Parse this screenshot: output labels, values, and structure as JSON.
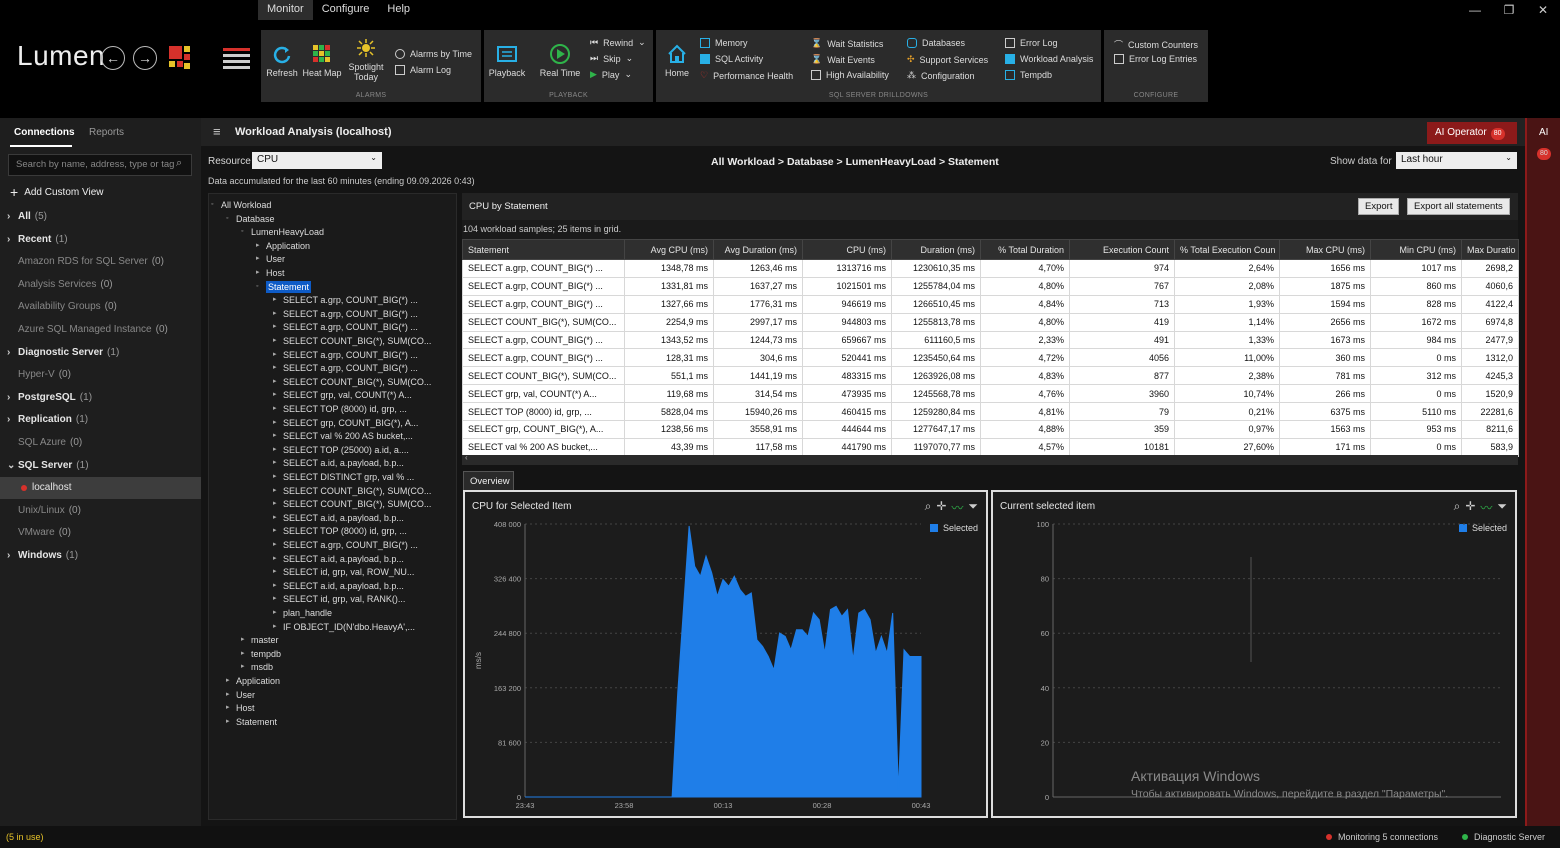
{
  "menu": [
    "Monitor",
    "Configure",
    "Help"
  ],
  "app": {
    "logo": "Lumen"
  },
  "ribbon": {
    "alarms": {
      "label": "ALARMS",
      "refresh": "Refresh",
      "heatmap": "Heat Map",
      "spotlight": "Spotlight Today",
      "alarms_by_time": "Alarms by Time",
      "alarm_log": "Alarm Log"
    },
    "playback": {
      "label": "PLAYBACK",
      "playback": "Playback",
      "realtime": "Real Time",
      "rewind": "Rewind",
      "skip": "Skip",
      "play": "Play"
    },
    "drilldowns": {
      "label": "SQL SERVER DRILLDOWNS",
      "home": "Home",
      "memory": "Memory",
      "sql_activity": "SQL Activity",
      "performance_health": "Performance Health",
      "wait_statistics": "Wait Statistics",
      "wait_events": "Wait Events",
      "high_availability": "High Availability",
      "databases": "Databases",
      "support_services": "Support Services",
      "configuration": "Configuration",
      "error_log": "Error Log",
      "workload_analysis": "Workload Analysis",
      "tempdb": "Tempdb"
    },
    "configure": {
      "label": "CONFIGURE",
      "custom_counters": "Custom Counters",
      "error_log_entries": "Error Log Entries"
    }
  },
  "left": {
    "tabs": [
      "Connections",
      "Reports"
    ],
    "search_placeholder": "Search by name, address, type or tag",
    "add_custom_view": "Add Custom View",
    "items": [
      {
        "label": "All",
        "count": "(5)",
        "bold": true,
        "caret": true
      },
      {
        "label": "Recent",
        "count": "(1)",
        "bold": true,
        "caret": true
      },
      {
        "label": "Amazon RDS for SQL Server",
        "count": "(0)",
        "bold": false
      },
      {
        "label": "Analysis Services",
        "count": "(0)",
        "bold": false
      },
      {
        "label": "Availability Groups",
        "count": "(0)",
        "bold": false
      },
      {
        "label": "Azure SQL Managed Instance",
        "count": "(0)",
        "bold": false
      },
      {
        "label": "Diagnostic Server",
        "count": "(1)",
        "bold": true,
        "caret": true
      },
      {
        "label": "Hyper-V",
        "count": "(0)",
        "bold": false
      },
      {
        "label": "PostgreSQL",
        "count": "(1)",
        "bold": true,
        "caret": true
      },
      {
        "label": "Replication",
        "count": "(1)",
        "bold": true,
        "caret": true
      },
      {
        "label": "SQL Azure",
        "count": "(0)",
        "bold": false
      },
      {
        "label": "SQL Server",
        "count": "(1)",
        "bold": true,
        "caret": true,
        "open": true
      },
      {
        "label": "localhost",
        "count": "",
        "bold": false,
        "child": true,
        "selected": true
      },
      {
        "label": "Unix/Linux",
        "count": "(0)",
        "bold": false
      },
      {
        "label": "VMware",
        "count": "(0)",
        "bold": false
      },
      {
        "label": "Windows",
        "count": "(1)",
        "bold": true,
        "caret": true
      }
    ]
  },
  "main": {
    "title": "Workload Analysis (localhost)",
    "ai_operator": "AI Operator",
    "ai_badge": "80",
    "ai_strip": "AI",
    "resource_label": "Resource",
    "resource_value": "CPU",
    "accumulated": "Data accumulated for the last 60 minutes (ending 09.09.2026 0:43)",
    "breadcrumb": "All Workload > Database > LumenHeavyLoad > Statement",
    "show_data_for": "Show data for",
    "period": "Last hour"
  },
  "tree": [
    {
      "t": "All Workload",
      "l": 0,
      "c": "◦"
    },
    {
      "t": "Database",
      "l": 1,
      "c": "◦"
    },
    {
      "t": "LumenHeavyLoad",
      "l": 2,
      "c": "◦"
    },
    {
      "t": "Application",
      "l": 3,
      "c": "▸"
    },
    {
      "t": "User",
      "l": 3,
      "c": "▸"
    },
    {
      "t": "Host",
      "l": 3,
      "c": "▸"
    },
    {
      "t": "Statement",
      "l": 3,
      "c": "◦",
      "sel": true
    },
    {
      "t": "SELECT a.grp, COUNT_BIG(*) ...",
      "l": 4,
      "c": "▸"
    },
    {
      "t": "SELECT a.grp, COUNT_BIG(*) ...",
      "l": 4,
      "c": "▸"
    },
    {
      "t": "SELECT a.grp, COUNT_BIG(*) ...",
      "l": 4,
      "c": "▸"
    },
    {
      "t": "SELECT COUNT_BIG(*), SUM(CO...",
      "l": 4,
      "c": "▸"
    },
    {
      "t": "SELECT a.grp, COUNT_BIG(*) ...",
      "l": 4,
      "c": "▸"
    },
    {
      "t": "SELECT a.grp, COUNT_BIG(*) ...",
      "l": 4,
      "c": "▸"
    },
    {
      "t": "SELECT COUNT_BIG(*), SUM(CO...",
      "l": 4,
      "c": "▸"
    },
    {
      "t": "SELECT grp, val, COUNT(*) A...",
      "l": 4,
      "c": "▸"
    },
    {
      "t": "SELECT TOP (8000) id, grp, ...",
      "l": 4,
      "c": "▸"
    },
    {
      "t": "SELECT grp, COUNT_BIG(*), A...",
      "l": 4,
      "c": "▸"
    },
    {
      "t": "SELECT val % 200 AS bucket,...",
      "l": 4,
      "c": "▸"
    },
    {
      "t": "SELECT TOP (25000) a.id, a....",
      "l": 4,
      "c": "▸"
    },
    {
      "t": "SELECT a.id, a.payload, b.p...",
      "l": 4,
      "c": "▸"
    },
    {
      "t": "SELECT DISTINCT grp, val % ...",
      "l": 4,
      "c": "▸"
    },
    {
      "t": "SELECT COUNT_BIG(*), SUM(CO...",
      "l": 4,
      "c": "▸"
    },
    {
      "t": "SELECT COUNT_BIG(*), SUM(CO...",
      "l": 4,
      "c": "▸"
    },
    {
      "t": "SELECT a.id, a.payload, b.p...",
      "l": 4,
      "c": "▸"
    },
    {
      "t": "SELECT TOP (8000) id, grp, ...",
      "l": 4,
      "c": "▸"
    },
    {
      "t": "SELECT a.grp, COUNT_BIG(*) ...",
      "l": 4,
      "c": "▸"
    },
    {
      "t": "SELECT a.id, a.payload, b.p...",
      "l": 4,
      "c": "▸"
    },
    {
      "t": "SELECT id, grp, val, ROW_NU...",
      "l": 4,
      "c": "▸"
    },
    {
      "t": "SELECT a.id, a.payload, b.p...",
      "l": 4,
      "c": "▸"
    },
    {
      "t": "SELECT id, grp, val, RANK()...",
      "l": 4,
      "c": "▸"
    },
    {
      "t": "plan_handle",
      "l": 4,
      "c": "▸"
    },
    {
      "t": "IF OBJECT_ID(N'dbo.HeavyA',...",
      "l": 4,
      "c": "▸"
    },
    {
      "t": "master",
      "l": 2,
      "c": "▸"
    },
    {
      "t": "tempdb",
      "l": 2,
      "c": "▸"
    },
    {
      "t": "msdb",
      "l": 2,
      "c": "▸"
    },
    {
      "t": "Application",
      "l": 1,
      "c": "▸"
    },
    {
      "t": "User",
      "l": 1,
      "c": "▸"
    },
    {
      "t": "Host",
      "l": 1,
      "c": "▸"
    },
    {
      "t": "Statement",
      "l": 1,
      "c": "▸"
    }
  ],
  "grid": {
    "title": "CPU by Statement",
    "export": "Export",
    "export_all": "Export all statements",
    "summary": "104 workload samples; 25 items in grid.",
    "columns": [
      "Statement",
      "Avg CPU (ms)",
      "Avg Duration (ms)",
      "CPU (ms)",
      "Duration (ms)",
      "% Total Duration",
      "Execution Count",
      "% Total Execution Coun",
      "Max CPU (ms)",
      "Min CPU (ms)",
      "Max Duratio"
    ],
    "rows": [
      [
        "SELECT a.grp, COUNT_BIG(*) ...",
        "1348,78 ms",
        "1263,46 ms",
        "1313716 ms",
        "1230610,35 ms",
        "4,70%",
        "974",
        "2,64%",
        "1656 ms",
        "1017 ms",
        "2698,2"
      ],
      [
        "SELECT a.grp, COUNT_BIG(*) ...",
        "1331,81 ms",
        "1637,27 ms",
        "1021501 ms",
        "1255784,04 ms",
        "4,80%",
        "767",
        "2,08%",
        "1875 ms",
        "860 ms",
        "4060,6"
      ],
      [
        "SELECT a.grp, COUNT_BIG(*) ...",
        "1327,66 ms",
        "1776,31 ms",
        "946619 ms",
        "1266510,45 ms",
        "4,84%",
        "713",
        "1,93%",
        "1594 ms",
        "828 ms",
        "4122,4"
      ],
      [
        "SELECT COUNT_BIG(*), SUM(CO...",
        "2254,9 ms",
        "2997,17 ms",
        "944803 ms",
        "1255813,78 ms",
        "4,80%",
        "419",
        "1,14%",
        "2656 ms",
        "1672 ms",
        "6974,8"
      ],
      [
        "SELECT a.grp, COUNT_BIG(*) ...",
        "1343,52 ms",
        "1244,73 ms",
        "659667 ms",
        "611160,5 ms",
        "2,33%",
        "491",
        "1,33%",
        "1673 ms",
        "984 ms",
        "2477,9"
      ],
      [
        "SELECT a.grp, COUNT_BIG(*) ...",
        "128,31 ms",
        "304,6 ms",
        "520441 ms",
        "1235450,64 ms",
        "4,72%",
        "4056",
        "11,00%",
        "360 ms",
        "0 ms",
        "1312,0"
      ],
      [
        "SELECT COUNT_BIG(*), SUM(CO...",
        "551,1 ms",
        "1441,19 ms",
        "483315 ms",
        "1263926,08 ms",
        "4,83%",
        "877",
        "2,38%",
        "781 ms",
        "312 ms",
        "4245,3"
      ],
      [
        "SELECT grp, val, COUNT(*) A...",
        "119,68 ms",
        "314,54 ms",
        "473935 ms",
        "1245568,78 ms",
        "4,76%",
        "3960",
        "10,74%",
        "266 ms",
        "0 ms",
        "1520,9"
      ],
      [
        "SELECT TOP (8000) id, grp, ...",
        "5828,04 ms",
        "15940,26 ms",
        "460415 ms",
        "1259280,84 ms",
        "4,81%",
        "79",
        "0,21%",
        "6375 ms",
        "5110 ms",
        "22281,6"
      ],
      [
        "SELECT grp, COUNT_BIG(*), A...",
        "1238,56 ms",
        "3558,91 ms",
        "444644 ms",
        "1277647,17 ms",
        "4,88%",
        "359",
        "0,97%",
        "1563 ms",
        "953 ms",
        "8211,6"
      ],
      [
        "SELECT val % 200 AS bucket,...",
        "43,39 ms",
        "117,58 ms",
        "441790 ms",
        "1197070,77 ms",
        "4,57%",
        "10181",
        "27,60%",
        "171 ms",
        "0 ms",
        "583,9"
      ]
    ]
  },
  "overview_tab": "Overview",
  "chart_data": [
    {
      "type": "area",
      "title": "CPU for Selected Item",
      "ylabel": "ms/s",
      "legend": "Selected",
      "legend_position": "top-right",
      "ylim": [
        0,
        408000
      ],
      "yticks": [
        "408 000",
        "326 400",
        "244 800",
        "163 200",
        "81 600",
        "0"
      ],
      "xticks": [
        "23:43",
        "23:58",
        "00:13",
        "00:28",
        "00:43"
      ],
      "x_minutes": [
        0,
        26,
        27,
        29,
        30,
        31,
        32,
        33,
        34,
        35,
        36,
        37,
        38,
        39,
        40,
        41,
        42,
        43,
        44,
        45,
        46,
        47,
        48,
        49,
        50,
        51,
        52,
        53,
        54,
        55,
        56,
        57,
        58,
        59,
        60,
        61,
        62,
        63,
        64,
        65,
        66,
        67,
        68,
        69,
        70
      ],
      "values": [
        0,
        0,
        155000,
        405000,
        345000,
        330000,
        360000,
        335000,
        300000,
        325000,
        315000,
        330000,
        310000,
        300000,
        305000,
        235000,
        225000,
        210000,
        190000,
        245000,
        240000,
        220000,
        250000,
        250000,
        240000,
        275000,
        265000,
        215000,
        280000,
        285000,
        270000,
        280000,
        205000,
        275000,
        280000,
        265000,
        215000,
        240000,
        215000,
        275000,
        10000,
        220000,
        210000,
        210000,
        210000
      ]
    },
    {
      "type": "line",
      "title": "Current selected item",
      "legend": "Selected",
      "legend_position": "top-right",
      "ylim": [
        0,
        100
      ],
      "yticks": [
        "100",
        "80",
        "60",
        "40",
        "20",
        "0"
      ]
    }
  ],
  "watermark": {
    "line1": "Активация Windows",
    "line2": "Чтобы активировать Windows, перейдите в раздел \"Параметры\"."
  },
  "status": {
    "left": "(5 in use)",
    "monitoring": "Monitoring 5 connections",
    "diagnostic": "Diagnostic Server"
  },
  "colors": {
    "accent": "#1f7ee8",
    "ai_red": "#8c1a1a",
    "selection": "#0e5bc6"
  }
}
